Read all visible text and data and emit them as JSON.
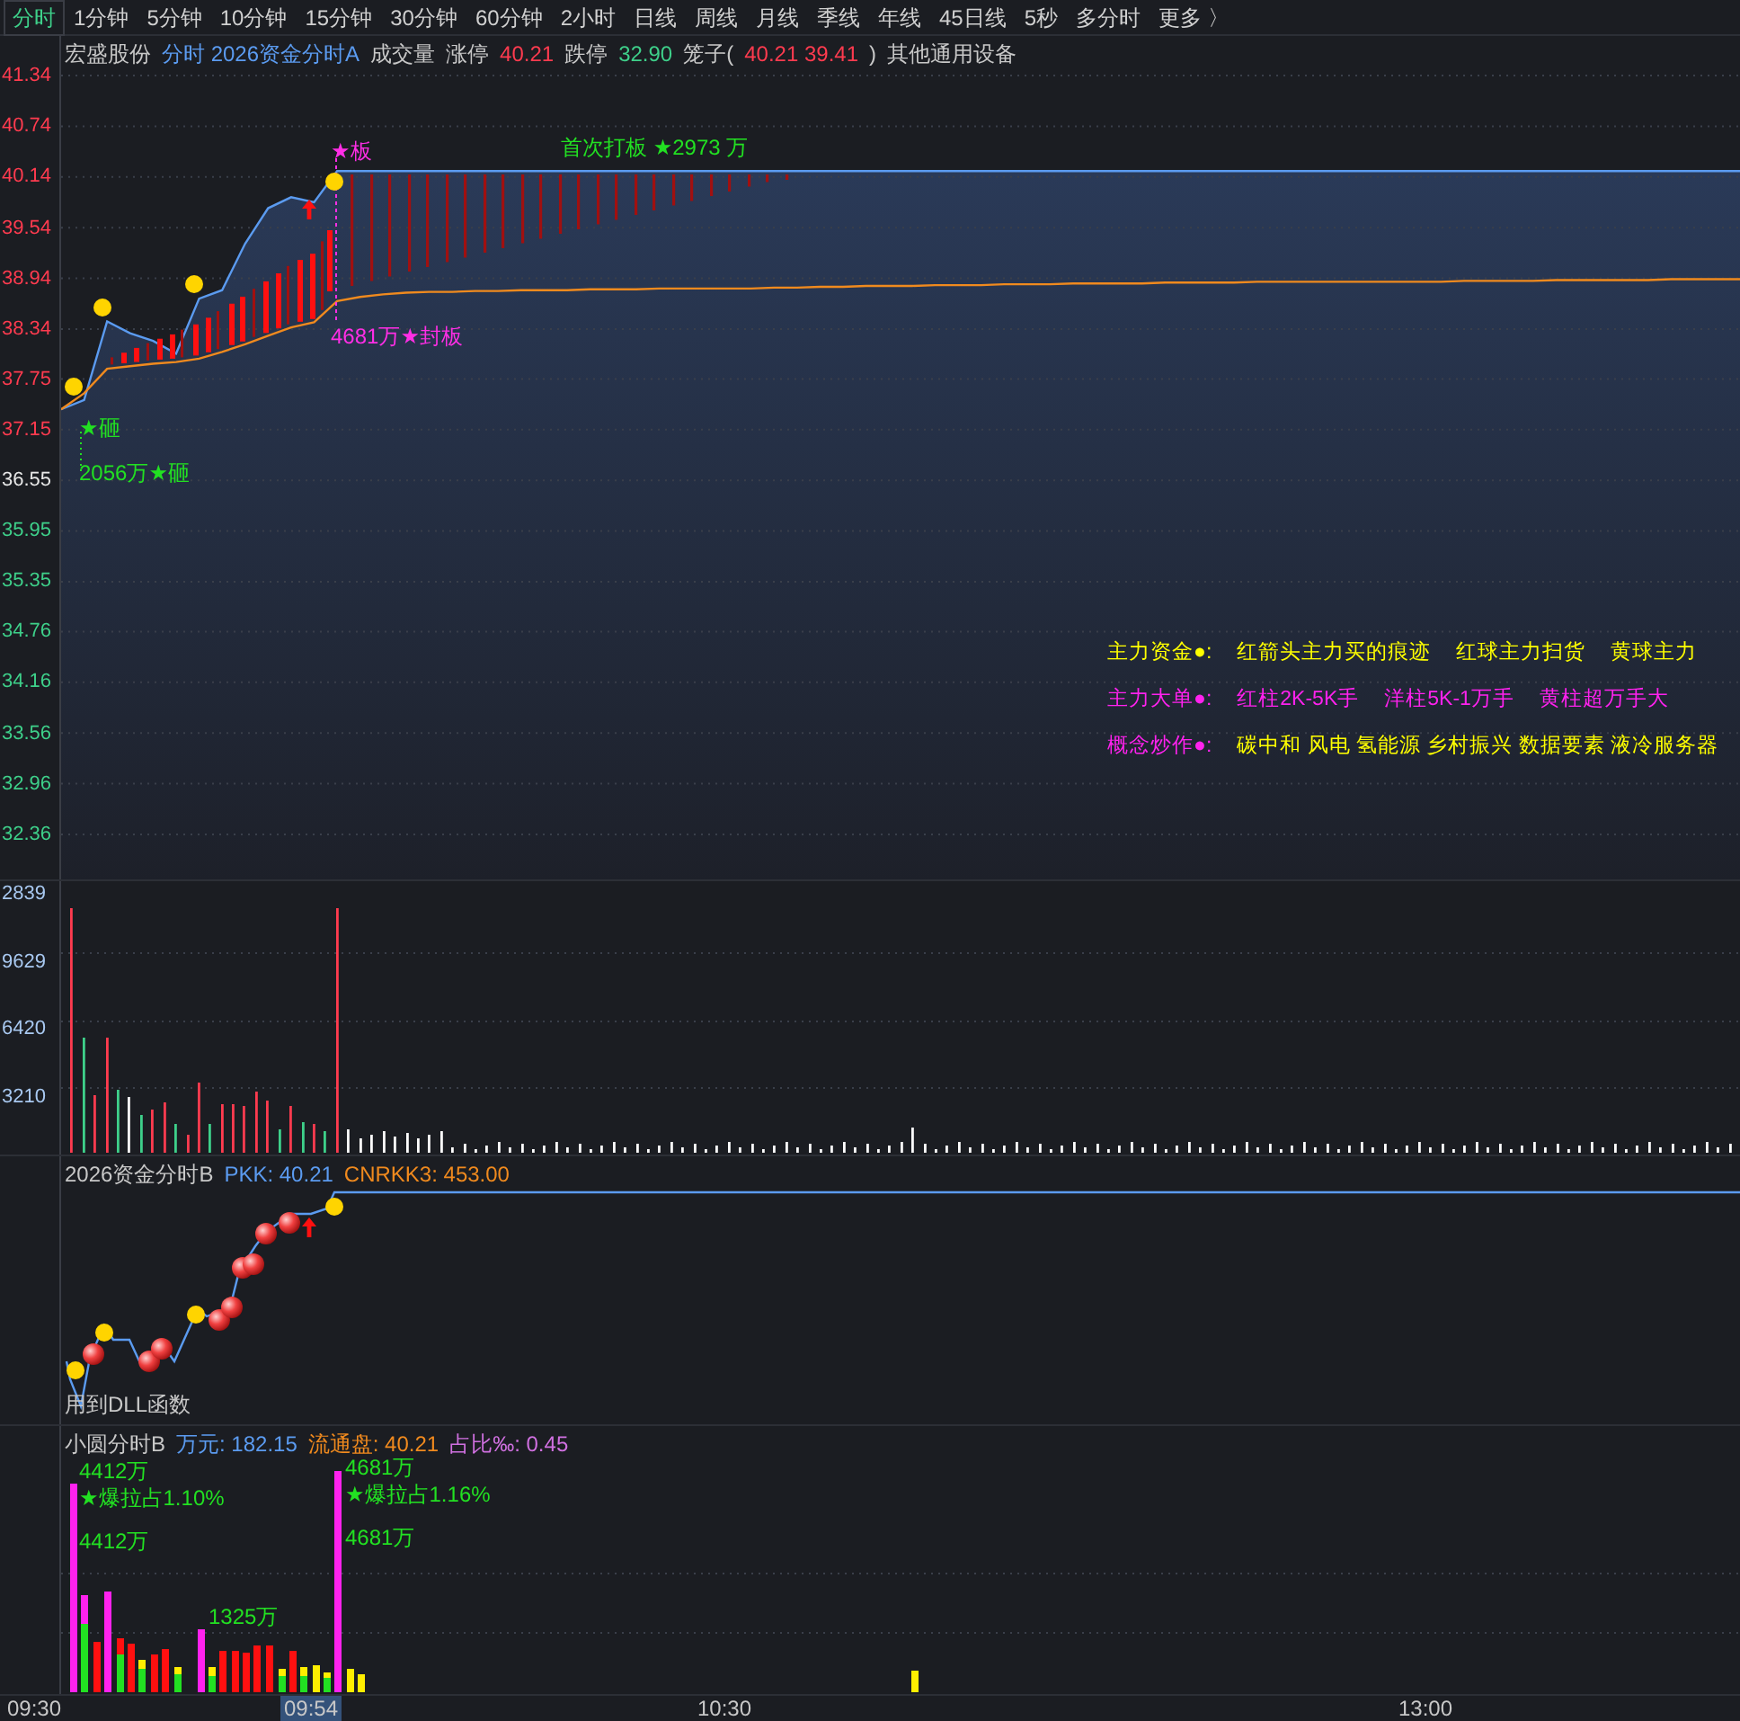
{
  "period_tabs": [
    {
      "label": "分时",
      "selected": true
    },
    {
      "label": "1分钟",
      "selected": false
    },
    {
      "label": "5分钟",
      "selected": false
    },
    {
      "label": "10分钟",
      "selected": false
    },
    {
      "label": "15分钟",
      "selected": false
    },
    {
      "label": "30分钟",
      "selected": false
    },
    {
      "label": "60分钟",
      "selected": false
    },
    {
      "label": "2小时",
      "selected": false
    },
    {
      "label": "日线",
      "selected": false
    },
    {
      "label": "周线",
      "selected": false
    },
    {
      "label": "月线",
      "selected": false
    },
    {
      "label": "季线",
      "selected": false
    },
    {
      "label": "年线",
      "selected": false
    },
    {
      "label": "45日线",
      "selected": false
    },
    {
      "label": "5秒",
      "selected": false
    },
    {
      "label": "多分时",
      "selected": false
    },
    {
      "label": "更多 〉",
      "selected": false
    }
  ],
  "price_panel": {
    "header": [
      {
        "text": "宏盛股份",
        "color": "#c8c8c8"
      },
      {
        "text": "分时 2026资金分时A",
        "color": "#5b9bf0"
      },
      {
        "text": "成交量",
        "color": "#c8c8c8"
      },
      {
        "text": "涨停",
        "color": "#c8c8c8"
      },
      {
        "text": "40.21",
        "color": "#ff3b4f"
      },
      {
        "text": "跌停",
        "color": "#c8c8c8"
      },
      {
        "text": "32.90",
        "color": "#3ed08a"
      },
      {
        "text": "笼子(",
        "color": "#c8c8c8"
      },
      {
        "text": "40.21 39.41",
        "color": "#ff3b4f"
      },
      {
        "text": ")",
        "color": "#c8c8c8"
      },
      {
        "text": "其他通用设备",
        "color": "#c8c8c8"
      }
    ],
    "axis": [
      {
        "text": "41.34",
        "color": "#ff3b4f"
      },
      {
        "text": "40.74",
        "color": "#ff3b4f"
      },
      {
        "text": "40.14",
        "color": "#ff3b4f"
      },
      {
        "text": "39.54",
        "color": "#ff3b4f"
      },
      {
        "text": "38.94",
        "color": "#ff3b4f"
      },
      {
        "text": "38.34",
        "color": "#ff3b4f"
      },
      {
        "text": "37.75",
        "color": "#ff3b4f"
      },
      {
        "text": "37.15",
        "color": "#ff3b4f"
      },
      {
        "text": "36.55",
        "color": "#e8e8e8"
      },
      {
        "text": "35.95",
        "color": "#3ed08a"
      },
      {
        "text": "35.35",
        "color": "#3ed08a"
      },
      {
        "text": "34.76",
        "color": "#3ed08a"
      },
      {
        "text": "34.16",
        "color": "#3ed08a"
      },
      {
        "text": "33.56",
        "color": "#3ed08a"
      },
      {
        "text": "32.96",
        "color": "#3ed08a"
      },
      {
        "text": "32.36",
        "color": "#3ed08a"
      }
    ],
    "chart_data": {
      "type": "line",
      "grid": true,
      "ylim": [
        32.36,
        41.34
      ],
      "yticks": [
        41.34,
        40.74,
        40.14,
        39.54,
        38.94,
        38.34,
        37.75,
        37.15,
        36.55,
        35.95,
        35.35,
        34.76,
        34.16,
        33.56,
        32.96,
        32.36
      ],
      "series": [
        {
          "color": "#5b9bf0",
          "values": [
            37.39,
            37.5,
            38.43,
            38.29,
            38.2,
            38.05,
            38.7,
            38.8,
            39.35,
            39.77,
            39.9,
            39.84,
            40.21,
            40.21,
            40.21,
            40.21,
            40.21,
            40.21,
            40.21,
            40.21,
            40.21,
            40.21,
            40.21,
            40.21,
            40.21,
            40.21,
            40.21,
            40.21,
            40.21,
            40.21,
            40.21,
            40.21,
            40.21,
            40.21,
            40.21,
            40.21,
            40.21,
            40.21,
            40.21,
            40.21,
            40.21,
            40.21,
            40.21,
            40.21,
            40.21,
            40.21,
            40.21,
            40.21,
            40.21,
            40.21,
            40.21,
            40.21,
            40.21,
            40.21,
            40.21,
            40.21,
            40.21,
            40.21,
            40.21,
            40.21,
            40.21,
            40.21,
            40.21,
            40.21,
            40.21,
            40.21,
            40.21,
            40.21,
            40.21,
            40.21,
            40.21,
            40.21,
            40.21,
            40.21
          ]
        },
        {
          "color": "#f08a1e",
          "values": [
            37.39,
            37.58,
            37.87,
            37.9,
            37.93,
            37.95,
            37.99,
            38.07,
            38.16,
            38.26,
            38.36,
            38.42,
            38.67,
            38.72,
            38.75,
            38.77,
            38.78,
            38.78,
            38.79,
            38.79,
            38.8,
            38.8,
            38.8,
            38.81,
            38.81,
            38.81,
            38.82,
            38.82,
            38.82,
            38.82,
            38.82,
            38.83,
            38.83,
            38.84,
            38.84,
            38.85,
            38.85,
            38.85,
            38.86,
            38.86,
            38.86,
            38.87,
            38.87,
            38.87,
            38.88,
            38.88,
            38.88,
            38.88,
            38.89,
            38.89,
            38.89,
            38.89,
            38.9,
            38.9,
            38.9,
            38.9,
            38.9,
            38.9,
            38.9,
            38.9,
            38.9,
            38.91,
            38.91,
            38.91,
            38.91,
            38.92,
            38.92,
            38.92,
            38.92,
            38.92,
            38.93,
            38.93,
            38.93,
            38.93
          ]
        }
      ]
    },
    "annotations": [
      {
        "text": "★板",
        "color": "#ff2ee6"
      },
      {
        "text": "首次打板 ★2973 万",
        "color": "#22e022"
      },
      {
        "text": "4681万★封板",
        "color": "#ff2ee6"
      },
      {
        "text": "★砸",
        "color": "#22e022"
      },
      {
        "text": "2056万★砸",
        "color": "#22e022"
      }
    ],
    "legend": [
      {
        "label": {
          "text": "主力资金●:",
          "color": "#ffff00"
        },
        "items": [
          {
            "text": "红箭头主力买的痕迹",
            "color": "#ffff00"
          },
          {
            "text": "红球主力扫货",
            "color": "#ffff00"
          },
          {
            "text": "黄球主力",
            "color": "#ffff00"
          }
        ]
      },
      {
        "label": {
          "text": "主力大单●:",
          "color": "#ff22ee"
        },
        "items": [
          {
            "text": "红柱2K-5K手",
            "color": "#ff22ee"
          },
          {
            "text": "洋柱5K-1万手",
            "color": "#ff22ee"
          },
          {
            "text": "黄柱超万手大",
            "color": "#ff22ee"
          }
        ]
      },
      {
        "label": {
          "text": "概念炒作●:",
          "color": "#ff22ee"
        },
        "items": [
          {
            "text": "碳中和 风电 氢能源 乡村振兴 数据要素 液冷服务器",
            "color": "#ffff00"
          }
        ]
      }
    ]
  },
  "volume_panel": {
    "axis": [
      "2839",
      "9629",
      "6420",
      "3210"
    ]
  },
  "panel_b": {
    "header": [
      {
        "text": "2026资金分时B",
        "color": "#c8c8c8"
      },
      {
        "text": "PKK: 40.21",
        "color": "#5b9bf0"
      },
      {
        "text": "CNRKK3: 453.00",
        "color": "#f08a1e"
      }
    ],
    "footer": "用到DLL函数"
  },
  "panel_c": {
    "header": [
      {
        "text": "小圆分时B",
        "color": "#c8c8c8"
      },
      {
        "text": "万元: 182.15",
        "color": "#5b9bf0"
      },
      {
        "text": "流通盘: 40.21",
        "color": "#f08a1e"
      },
      {
        "text": "占比‰: 0.45",
        "color": "#d070e0"
      }
    ],
    "annotations": [
      "4412万",
      "★爆拉占1.10%",
      "4412万",
      "1325万",
      "4681万",
      "★爆拉占1.16%",
      "4681万"
    ]
  },
  "time_axis": [
    {
      "text": "09:30",
      "selected": false
    },
    {
      "text": "09:54",
      "selected": true
    },
    {
      "text": "10:30",
      "selected": false
    },
    {
      "text": "13:00",
      "selected": false
    }
  ]
}
